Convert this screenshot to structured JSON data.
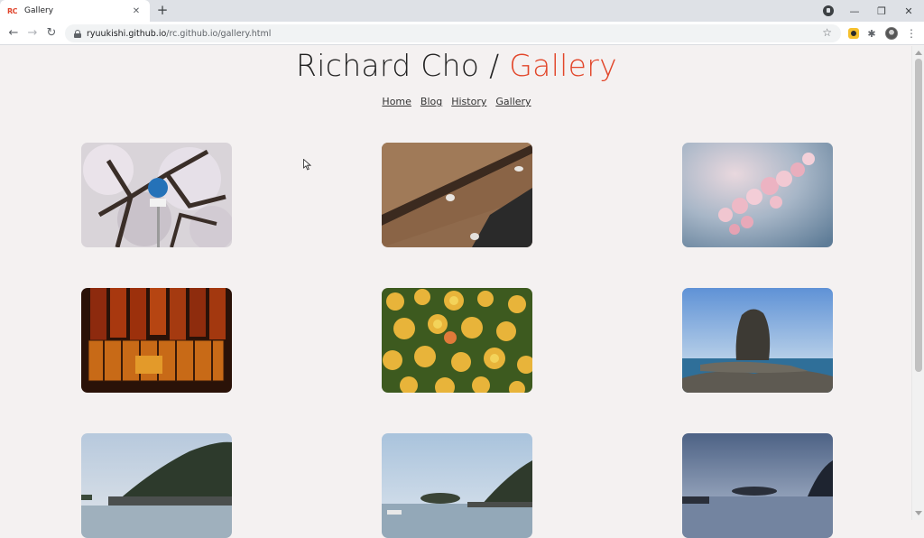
{
  "browser": {
    "tab": {
      "favicon": "RC",
      "title": "Gallery",
      "close": "✕"
    },
    "new_tab": "+",
    "url_host": "ryuukishi.github.io",
    "url_path": "/rc.github.io/gallery.html",
    "window_controls": {
      "minimize": "—",
      "restore": "❐",
      "close": "✕"
    },
    "toolbar_icons": [
      "back-icon",
      "forward-icon",
      "reload-icon",
      "bookmark-star-icon",
      "extension-icon",
      "puzzle-icon",
      "avatar",
      "menu-icon"
    ]
  },
  "site": {
    "title_name": "Richard Cho / ",
    "title_accent": "Gallery",
    "accent_color": "#e2462a",
    "nav": [
      "Home",
      "Blog",
      "History",
      "Gallery"
    ]
  },
  "gallery": {
    "photos": [
      "cherry-blossom-tree-with-sign",
      "wooden-bench-with-petals",
      "pink-cherry-blossom-closeup",
      "lantern-wall",
      "yellow-tulips",
      "sea-rock-island",
      "bay-with-hills",
      "bay-with-boat",
      "bay-at-dusk"
    ]
  }
}
